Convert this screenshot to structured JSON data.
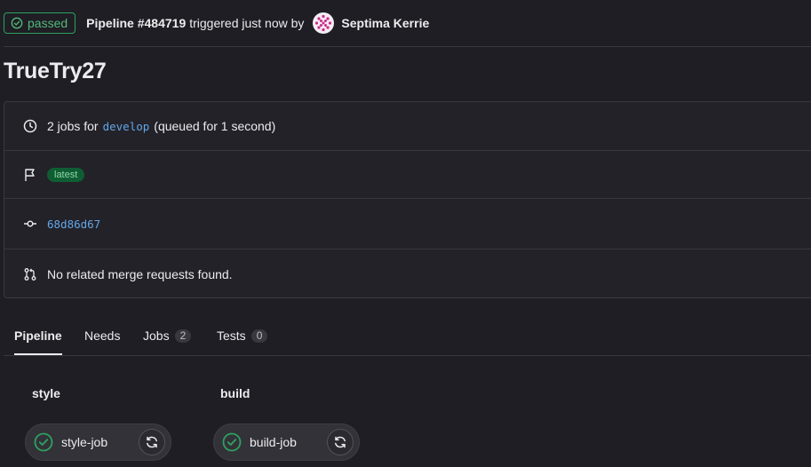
{
  "header": {
    "status_label": "passed",
    "pipeline_label": "Pipeline #484719",
    "triggered_text": "triggered just now by",
    "user_name": "Septima Kerrie"
  },
  "page_title": "TrueTry27",
  "info": {
    "jobs_prefix": "2 jobs for",
    "branch": "develop",
    "jobs_suffix": "(queued for 1 second)",
    "tag": "latest",
    "commit": "68d86d67",
    "merge_requests": "No related merge requests found."
  },
  "tabs": [
    {
      "label": "Pipeline",
      "active": true
    },
    {
      "label": "Needs"
    },
    {
      "label": "Jobs",
      "count": "2"
    },
    {
      "label": "Tests",
      "count": "0"
    }
  ],
  "stages": [
    {
      "name": "style",
      "job": "style-job",
      "status": "success"
    },
    {
      "name": "build",
      "job": "build-job",
      "status": "success"
    }
  ],
  "colors": {
    "success": "#2da160",
    "link": "#63a6e9",
    "background": "#1f1e24"
  },
  "icons": {
    "status": "check-circle-icon",
    "clock": "clock-icon",
    "flag": "flag-icon",
    "commit": "commit-icon",
    "merge": "merge-request-icon",
    "retry": "retry-icon"
  }
}
